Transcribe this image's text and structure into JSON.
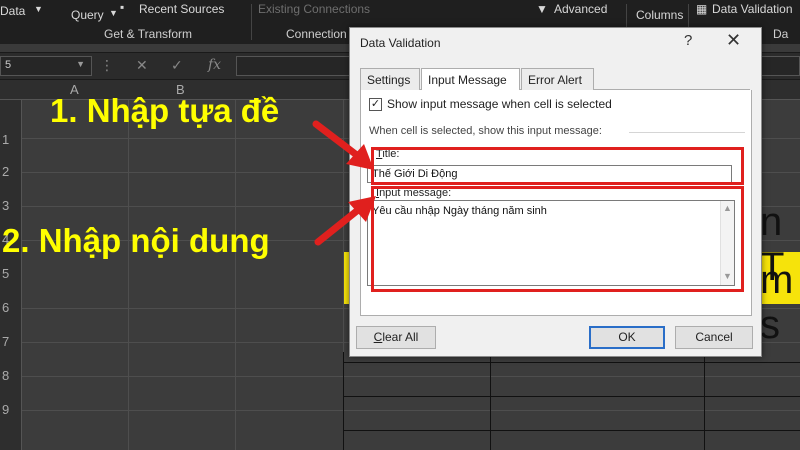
{
  "ribbon": {
    "data_label": "Data",
    "query_label": "Query",
    "recent_sources": "Recent Sources",
    "existing_connections": "Existing Connections",
    "advanced": "Advanced",
    "columns": "Columns",
    "data_validation": "Data Validation",
    "group_get_transform": "Get & Transform",
    "group_connections": "Connection",
    "group_data": "Da"
  },
  "formula_bar": {
    "name_box": "5",
    "fx": "fx"
  },
  "grid": {
    "columns": [
      "A",
      "B"
    ],
    "rows": [
      "1",
      "2",
      "3",
      "4",
      "5",
      "6",
      "7",
      "8",
      "9"
    ],
    "cell_text_row3": "n T",
    "cell_text_row4": "m s"
  },
  "dialog": {
    "title": "Data Validation",
    "help": "?",
    "close": "✕",
    "tabs": [
      "Settings",
      "Input Message",
      "Error Alert"
    ],
    "show_message_label": "Show input message when cell is selected",
    "show_message_checked": true,
    "section_label": "When cell is selected, show this input message:",
    "title_label": "Title:",
    "title_value": "Thế Giới Di Động",
    "message_label": "Input message:",
    "message_value": "Yêu cầu nhập Ngày tháng năm sinh",
    "clear_all": "Clear All",
    "ok": "OK",
    "cancel": "Cancel"
  },
  "annotations": {
    "step1": "1. Nhập tựa đề",
    "step2": "2. Nhập nội dung"
  },
  "colors": {
    "annotation": "#ffff00",
    "highlight": "#e0201e",
    "cell_fill": "#f6e30b"
  }
}
